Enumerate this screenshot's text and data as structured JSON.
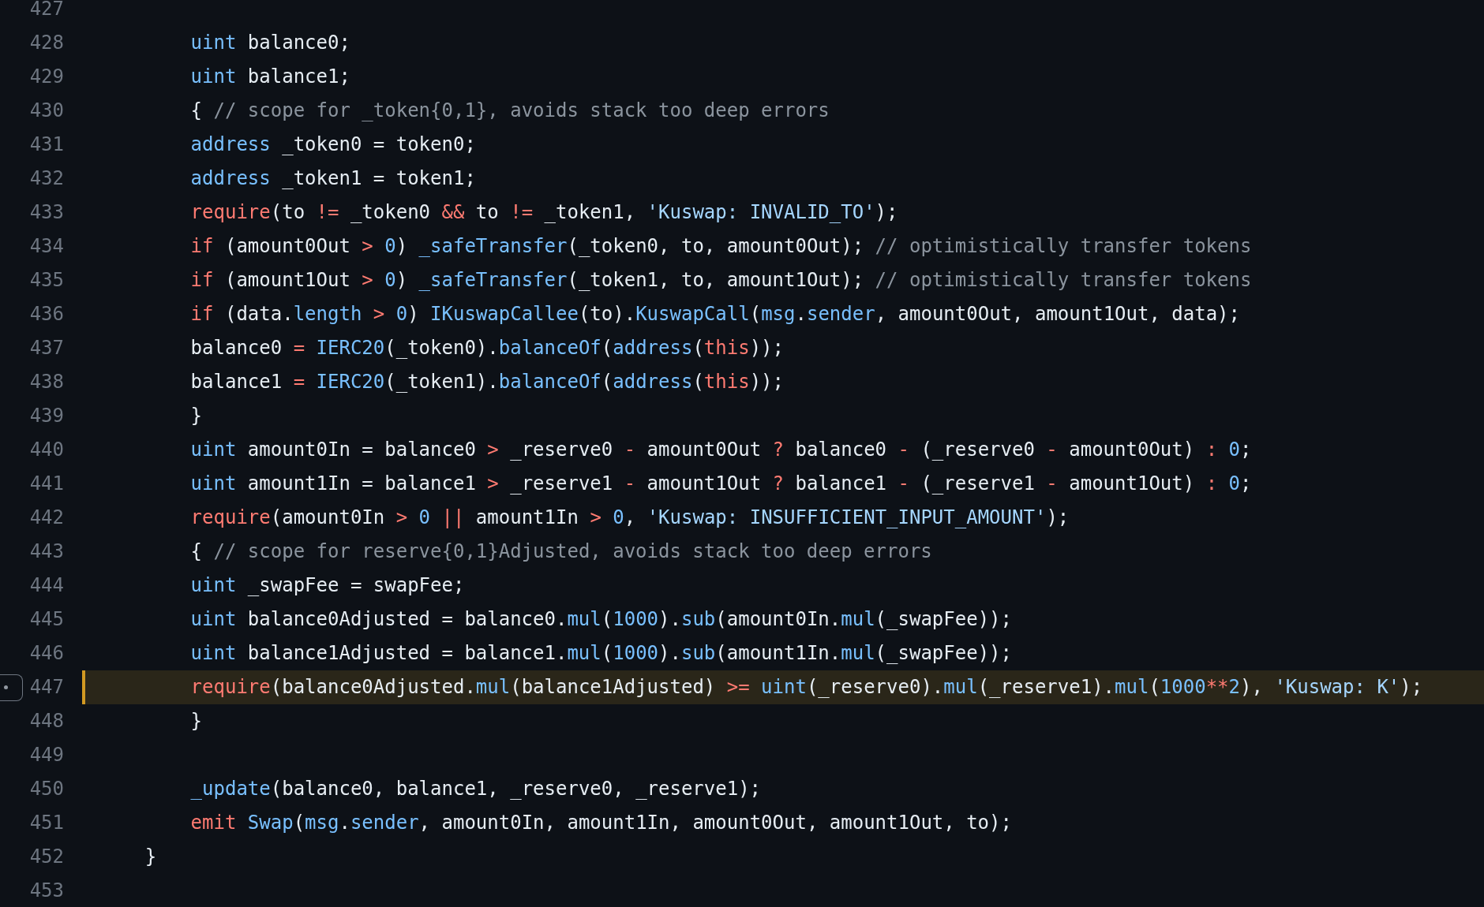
{
  "lines": [
    {
      "number": "427",
      "highlighted": false
    },
    {
      "number": "428",
      "highlighted": false,
      "tokens": [
        {
          "text": "        uint",
          "kind": "builtin"
        },
        {
          "text": " balance0;",
          "kind": "text"
        }
      ]
    },
    {
      "number": "429",
      "highlighted": false,
      "tokens": [
        {
          "text": "        uint",
          "kind": "builtin"
        },
        {
          "text": " balance1;",
          "kind": "text"
        }
      ]
    },
    {
      "number": "430",
      "highlighted": false,
      "tokens": [
        {
          "text": "        { ",
          "kind": "text"
        },
        {
          "text": "// scope for _token{0,1}, avoids stack too deep errors",
          "kind": "comment"
        }
      ]
    },
    {
      "number": "431",
      "highlighted": false,
      "tokens": [
        {
          "text": "        address",
          "kind": "builtin"
        },
        {
          "text": " _token0 = token0;",
          "kind": "text"
        }
      ]
    },
    {
      "number": "432",
      "highlighted": false,
      "tokens": [
        {
          "text": "        address",
          "kind": "builtin"
        },
        {
          "text": " _token1 = token1;",
          "kind": "text"
        }
      ]
    },
    {
      "number": "433",
      "highlighted": false,
      "tokens": [
        {
          "text": "        require",
          "kind": "keyword"
        },
        {
          "text": "(to ",
          "kind": "text"
        },
        {
          "text": "!=",
          "kind": "keyword"
        },
        {
          "text": " _token0 ",
          "kind": "text"
        },
        {
          "text": "&&",
          "kind": "keyword"
        },
        {
          "text": " to ",
          "kind": "text"
        },
        {
          "text": "!=",
          "kind": "keyword"
        },
        {
          "text": " _token1, ",
          "kind": "text"
        },
        {
          "text": "'Kuswap: INVALID_TO'",
          "kind": "string"
        },
        {
          "text": ");",
          "kind": "text"
        }
      ]
    },
    {
      "number": "434",
      "highlighted": false,
      "tokens": [
        {
          "text": "        if",
          "kind": "keyword"
        },
        {
          "text": " (amount0Out ",
          "kind": "text"
        },
        {
          "text": ">",
          "kind": "keyword"
        },
        {
          "text": " 0",
          "kind": "builtin"
        },
        {
          "text": ") ",
          "kind": "text"
        },
        {
          "text": "_safeTransfer",
          "kind": "builtin"
        },
        {
          "text": "(_token0, to, amount0Out); ",
          "kind": "text"
        },
        {
          "text": "// optimistically transfer tokens",
          "kind": "comment"
        }
      ]
    },
    {
      "number": "435",
      "highlighted": false,
      "tokens": [
        {
          "text": "        if",
          "kind": "keyword"
        },
        {
          "text": " (amount1Out ",
          "kind": "text"
        },
        {
          "text": ">",
          "kind": "keyword"
        },
        {
          "text": " 0",
          "kind": "builtin"
        },
        {
          "text": ") ",
          "kind": "text"
        },
        {
          "text": "_safeTransfer",
          "kind": "builtin"
        },
        {
          "text": "(_token1, to, amount1Out); ",
          "kind": "text"
        },
        {
          "text": "// optimistically transfer tokens",
          "kind": "comment"
        }
      ]
    },
    {
      "number": "436",
      "highlighted": false,
      "tokens": [
        {
          "text": "        if",
          "kind": "keyword"
        },
        {
          "text": " (data.",
          "kind": "text"
        },
        {
          "text": "length ",
          "kind": "builtin"
        },
        {
          "text": ">",
          "kind": "keyword"
        },
        {
          "text": " 0",
          "kind": "builtin"
        },
        {
          "text": ") ",
          "kind": "text"
        },
        {
          "text": "IKuswapCallee",
          "kind": "builtin"
        },
        {
          "text": "(to).",
          "kind": "text"
        },
        {
          "text": "KuswapCall",
          "kind": "builtin"
        },
        {
          "text": "(",
          "kind": "text"
        },
        {
          "text": "msg",
          "kind": "builtin"
        },
        {
          "text": ".",
          "kind": "text"
        },
        {
          "text": "sender",
          "kind": "builtin"
        },
        {
          "text": ", amount0Out, amount1Out, data);",
          "kind": "text"
        }
      ]
    },
    {
      "number": "437",
      "highlighted": false,
      "tokens": [
        {
          "text": "        balance0 ",
          "kind": "text"
        },
        {
          "text": "=",
          "kind": "keyword"
        },
        {
          "text": " IERC20",
          "kind": "builtin"
        },
        {
          "text": "(_token0).",
          "kind": "text"
        },
        {
          "text": "balanceOf",
          "kind": "builtin"
        },
        {
          "text": "(",
          "kind": "text"
        },
        {
          "text": "address",
          "kind": "builtin"
        },
        {
          "text": "(",
          "kind": "text"
        },
        {
          "text": "this",
          "kind": "keyword"
        },
        {
          "text": "));",
          "kind": "text"
        }
      ]
    },
    {
      "number": "438",
      "highlighted": false,
      "tokens": [
        {
          "text": "        balance1 ",
          "kind": "text"
        },
        {
          "text": "=",
          "kind": "keyword"
        },
        {
          "text": " IERC20",
          "kind": "builtin"
        },
        {
          "text": "(_token1).",
          "kind": "text"
        },
        {
          "text": "balanceOf",
          "kind": "builtin"
        },
        {
          "text": "(",
          "kind": "text"
        },
        {
          "text": "address",
          "kind": "builtin"
        },
        {
          "text": "(",
          "kind": "text"
        },
        {
          "text": "this",
          "kind": "keyword"
        },
        {
          "text": "));",
          "kind": "text"
        }
      ]
    },
    {
      "number": "439",
      "highlighted": false,
      "tokens": [
        {
          "text": "        }",
          "kind": "text"
        }
      ]
    },
    {
      "number": "440",
      "highlighted": false,
      "tokens": [
        {
          "text": "        uint",
          "kind": "builtin"
        },
        {
          "text": " amount0In = balance0 ",
          "kind": "text"
        },
        {
          "text": ">",
          "kind": "keyword"
        },
        {
          "text": " _reserve0 ",
          "kind": "text"
        },
        {
          "text": "-",
          "kind": "keyword"
        },
        {
          "text": " amount0Out ",
          "kind": "text"
        },
        {
          "text": "?",
          "kind": "keyword"
        },
        {
          "text": " balance0 ",
          "kind": "text"
        },
        {
          "text": "-",
          "kind": "keyword"
        },
        {
          "text": " (_reserve0 ",
          "kind": "text"
        },
        {
          "text": "-",
          "kind": "keyword"
        },
        {
          "text": " amount0Out) ",
          "kind": "text"
        },
        {
          "text": ":",
          "kind": "keyword"
        },
        {
          "text": " 0",
          "kind": "builtin"
        },
        {
          "text": ";",
          "kind": "text"
        }
      ]
    },
    {
      "number": "441",
      "highlighted": false,
      "tokens": [
        {
          "text": "        uint",
          "kind": "builtin"
        },
        {
          "text": " amount1In = balance1 ",
          "kind": "text"
        },
        {
          "text": ">",
          "kind": "keyword"
        },
        {
          "text": " _reserve1 ",
          "kind": "text"
        },
        {
          "text": "-",
          "kind": "keyword"
        },
        {
          "text": " amount1Out ",
          "kind": "text"
        },
        {
          "text": "?",
          "kind": "keyword"
        },
        {
          "text": " balance1 ",
          "kind": "text"
        },
        {
          "text": "-",
          "kind": "keyword"
        },
        {
          "text": " (_reserve1 ",
          "kind": "text"
        },
        {
          "text": "-",
          "kind": "keyword"
        },
        {
          "text": " amount1Out) ",
          "kind": "text"
        },
        {
          "text": ":",
          "kind": "keyword"
        },
        {
          "text": " 0",
          "kind": "builtin"
        },
        {
          "text": ";",
          "kind": "text"
        }
      ]
    },
    {
      "number": "442",
      "highlighted": false,
      "tokens": [
        {
          "text": "        require",
          "kind": "keyword"
        },
        {
          "text": "(amount0In ",
          "kind": "text"
        },
        {
          "text": ">",
          "kind": "keyword"
        },
        {
          "text": " 0 ",
          "kind": "builtin"
        },
        {
          "text": "||",
          "kind": "keyword"
        },
        {
          "text": " amount1In ",
          "kind": "text"
        },
        {
          "text": ">",
          "kind": "keyword"
        },
        {
          "text": " 0",
          "kind": "builtin"
        },
        {
          "text": ", ",
          "kind": "text"
        },
        {
          "text": "'Kuswap: INSUFFICIENT_INPUT_AMOUNT'",
          "kind": "string"
        },
        {
          "text": ");",
          "kind": "text"
        }
      ]
    },
    {
      "number": "443",
      "highlighted": false,
      "tokens": [
        {
          "text": "        { ",
          "kind": "text"
        },
        {
          "text": "// scope for reserve{0,1}Adjusted, avoids stack too deep errors",
          "kind": "comment"
        }
      ]
    },
    {
      "number": "444",
      "highlighted": false,
      "tokens": [
        {
          "text": "        uint",
          "kind": "builtin"
        },
        {
          "text": " _swapFee = swapFee;",
          "kind": "text"
        }
      ]
    },
    {
      "number": "445",
      "highlighted": false,
      "tokens": [
        {
          "text": "        uint",
          "kind": "builtin"
        },
        {
          "text": " balance0Adjusted = balance0.",
          "kind": "text"
        },
        {
          "text": "mul",
          "kind": "builtin"
        },
        {
          "text": "(",
          "kind": "text"
        },
        {
          "text": "1000",
          "kind": "builtin"
        },
        {
          "text": ").",
          "kind": "text"
        },
        {
          "text": "sub",
          "kind": "builtin"
        },
        {
          "text": "(amount0In.",
          "kind": "text"
        },
        {
          "text": "mul",
          "kind": "builtin"
        },
        {
          "text": "(_swapFee));",
          "kind": "text"
        }
      ]
    },
    {
      "number": "446",
      "highlighted": false,
      "tokens": [
        {
          "text": "        uint",
          "kind": "builtin"
        },
        {
          "text": " balance1Adjusted = balance1.",
          "kind": "text"
        },
        {
          "text": "mul",
          "kind": "builtin"
        },
        {
          "text": "(",
          "kind": "text"
        },
        {
          "text": "1000",
          "kind": "builtin"
        },
        {
          "text": ").",
          "kind": "text"
        },
        {
          "text": "sub",
          "kind": "builtin"
        },
        {
          "text": "(amount1In.",
          "kind": "text"
        },
        {
          "text": "mul",
          "kind": "builtin"
        },
        {
          "text": "(_swapFee));",
          "kind": "text"
        }
      ]
    },
    {
      "number": "447",
      "highlighted": true,
      "tokens": [
        {
          "text": "        require",
          "kind": "keyword"
        },
        {
          "text": "(balance0Adjusted.",
          "kind": "text"
        },
        {
          "text": "mul",
          "kind": "builtin"
        },
        {
          "text": "(balance1Adjusted) ",
          "kind": "text"
        },
        {
          "text": ">=",
          "kind": "keyword"
        },
        {
          "text": " uint",
          "kind": "builtin"
        },
        {
          "text": "(_reserve0).",
          "kind": "text"
        },
        {
          "text": "mul",
          "kind": "builtin"
        },
        {
          "text": "(_reserve1).",
          "kind": "text"
        },
        {
          "text": "mul",
          "kind": "builtin"
        },
        {
          "text": "(",
          "kind": "text"
        },
        {
          "text": "1000",
          "kind": "builtin"
        },
        {
          "text": "**",
          "kind": "keyword"
        },
        {
          "text": "2",
          "kind": "builtin"
        },
        {
          "text": "), ",
          "kind": "text"
        },
        {
          "text": "'Kuswap: K'",
          "kind": "string"
        },
        {
          "text": ");",
          "kind": "text"
        }
      ]
    },
    {
      "number": "448",
      "highlighted": false,
      "tokens": [
        {
          "text": "        }",
          "kind": "text"
        }
      ]
    },
    {
      "number": "449",
      "highlighted": false
    },
    {
      "number": "450",
      "highlighted": false,
      "tokens": [
        {
          "text": "        _update",
          "kind": "builtin"
        },
        {
          "text": "(balance0, balance1, _reserve0, _reserve1);",
          "kind": "text"
        }
      ]
    },
    {
      "number": "451",
      "highlighted": false,
      "tokens": [
        {
          "text": "        emit",
          "kind": "keyword"
        },
        {
          "text": " Swap",
          "kind": "builtin"
        },
        {
          "text": "(",
          "kind": "text"
        },
        {
          "text": "msg",
          "kind": "builtin"
        },
        {
          "text": ".",
          "kind": "text"
        },
        {
          "text": "sender",
          "kind": "builtin"
        },
        {
          "text": ", amount0In, amount1In, amount0Out, amount1Out, to);",
          "kind": "text"
        }
      ]
    },
    {
      "number": "452",
      "highlighted": false,
      "tokens": [
        {
          "text": "    }",
          "kind": "text"
        }
      ]
    },
    {
      "number": "453",
      "highlighted": false
    }
  ]
}
